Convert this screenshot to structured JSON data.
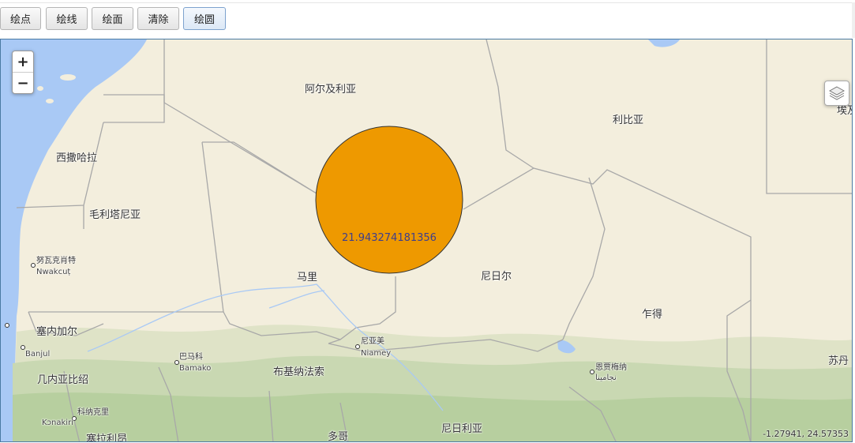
{
  "toolbar": {
    "buttons": [
      "绘点",
      "绘线",
      "绘面",
      "清除",
      "绘圆"
    ]
  },
  "map": {
    "zoom_in": "+",
    "zoom_out": "−",
    "layers_icon": "layers-icon",
    "circle": {
      "label": "21.943274181356",
      "fill": "#EE9900",
      "stroke": "#333333"
    },
    "labels": {
      "algeria": "阿尔及利亚",
      "libya": "利比亚",
      "egypt": "埃及",
      "western_sahara": "西撒哈拉",
      "mauritania": "毛利塔尼亚",
      "nouakchott_cn": "努瓦克肖特",
      "nouakchott": "Nwakcuṭ",
      "mali": "马里",
      "niger": "尼日尔",
      "chad": "乍得",
      "senegal": "塞内加尔",
      "banjul": "Banjul",
      "bamako_cn": "巴马科",
      "bamako": "Bamako",
      "niamey_cn": "尼亚美",
      "niamey": "Niamey",
      "ndjamena_cn": "恩贾梅纳",
      "ndjamena": "نجامينا",
      "burkina": "布基纳法索",
      "guinea": "几内亚比绍",
      "conakry_cn": "科纳克里",
      "conakry": "Kɔnakiri",
      "sierra": "塞拉利昂",
      "togo": "多哥",
      "nigeria": "尼日利亚",
      "sudan": "苏丹"
    },
    "coordinates": "-1.27941, 24.57353"
  }
}
